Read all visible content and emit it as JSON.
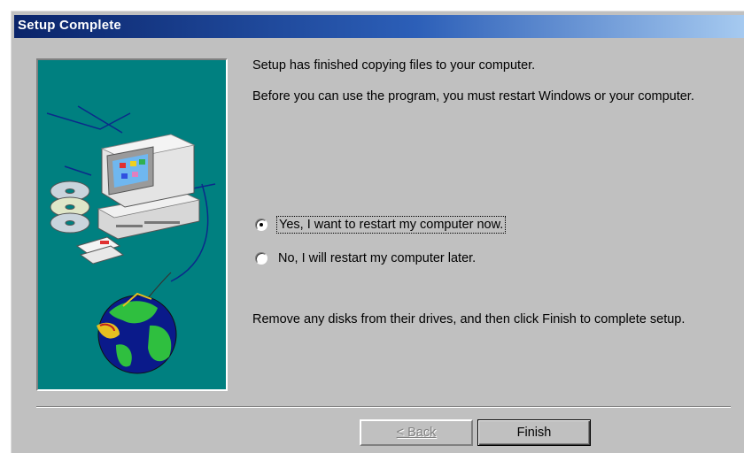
{
  "window": {
    "title": "Setup Complete"
  },
  "content": {
    "line1": "Setup has finished copying files to your computer.",
    "line2": "Before you can use the program, you must restart Windows or your computer.",
    "options": [
      {
        "label": "Yes, I want to restart my computer now.",
        "selected": true
      },
      {
        "label": "No, I will restart my computer later.",
        "selected": false
      }
    ],
    "instruction": "Remove any disks from their drives, and then click Finish to complete setup."
  },
  "buttons": {
    "back": "< Back",
    "finish": "Finish"
  },
  "colors": {
    "art_background": "#008080",
    "dialog_face": "#c0c0c0",
    "titlebar_start": "#0a246a",
    "titlebar_end": "#a6caf0"
  },
  "illustration": {
    "icons": [
      "computer-icon",
      "cd-icon",
      "floppy-disk-icon",
      "globe-icon"
    ]
  }
}
